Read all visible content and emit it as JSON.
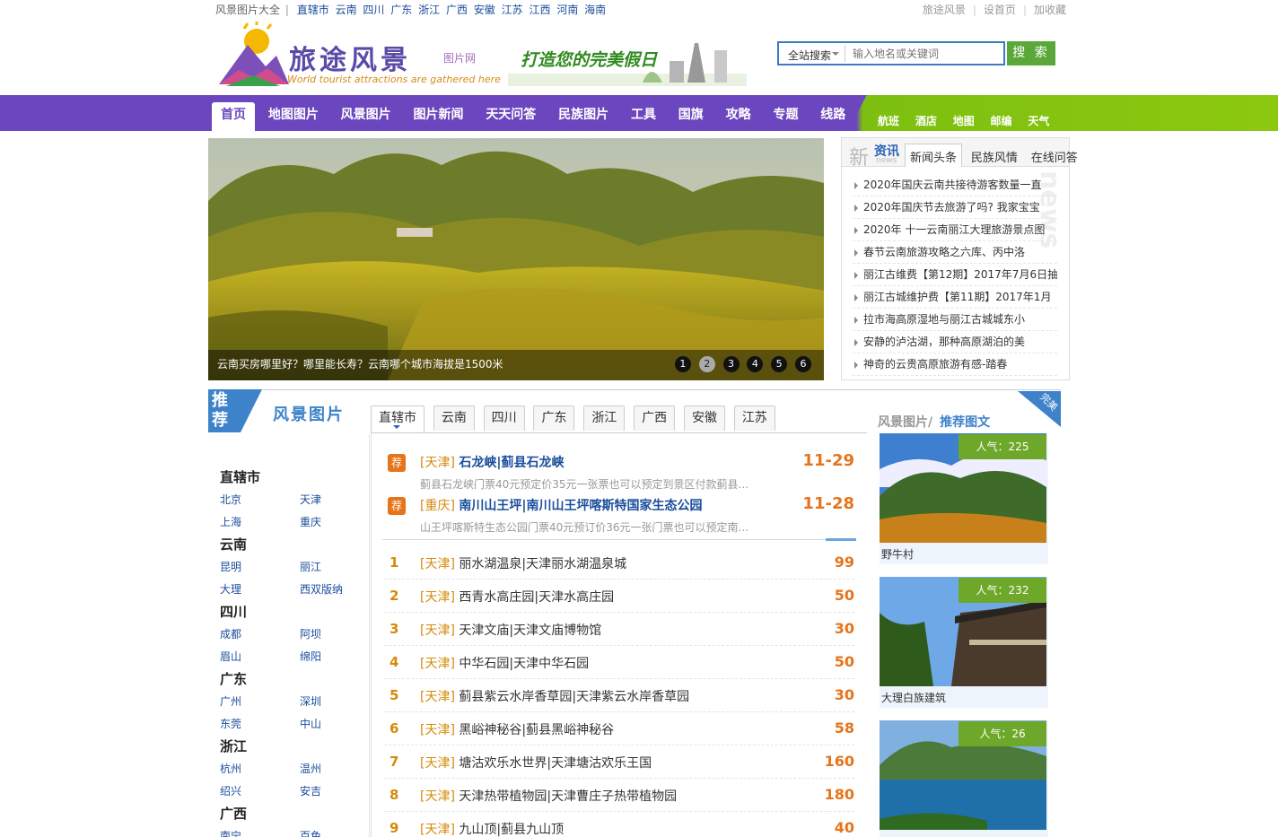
{
  "topbar": {
    "site_label": "风景图片大全",
    "cities": [
      "直辖市",
      "云南",
      "四川",
      "广东",
      "浙江",
      "广西",
      "安徽",
      "江苏",
      "江西",
      "河南",
      "海南"
    ],
    "links": [
      "旅途风景",
      "设首页",
      "加收藏"
    ]
  },
  "header": {
    "logo_title": "旅途风景",
    "logo_sub": "图片网",
    "logo_en": "World tourist attractions are gathered here",
    "slogan": "打造您的完美假日"
  },
  "search": {
    "scope": "全站搜索",
    "placeholder": "输入地名或关键词",
    "button": "搜 索"
  },
  "nav": {
    "items": [
      "首页",
      "地图图片",
      "风景图片",
      "图片新闻",
      "天天问答",
      "民族图片",
      "工具",
      "国旗",
      "攻略",
      "专题",
      "线路"
    ],
    "sub": [
      "航班",
      "酒店",
      "地图",
      "邮编",
      "天气"
    ]
  },
  "banner": {
    "caption": "云南买房哪里好？哪里能长寿？云南哪个城市海拔是1500米",
    "dots": [
      "1",
      "2",
      "3",
      "4",
      "5",
      "6"
    ],
    "active_dot": 2
  },
  "news": {
    "brand_a": "新",
    "brand_b": "资讯",
    "brand_c": "news",
    "watermark": "news",
    "tabs": [
      "新闻头条",
      "民族风情",
      "在线问答"
    ],
    "items": [
      "2020年国庆云南共接待游客数量一直",
      "2020年国庆节去旅游了吗? 我家宝宝",
      "2020年 十一云南丽江大理旅游景点图",
      "春节云南旅游攻略之六库、丙中洛",
      "丽江古维费【第12期】2017年7月6日抽",
      "丽江古城维护费【第11期】2017年1月",
      "拉市海高原湿地与丽江古城城东小",
      "安静的泸沽湖，那种高原湖泊的美",
      "神奇的云贵高原旅游有感-踏春"
    ]
  },
  "recommend": {
    "badge": "推荐",
    "title": "风景图片",
    "side_groups": [
      {
        "name": "直辖市",
        "cities": [
          "北京",
          "天津",
          "上海",
          "重庆"
        ]
      },
      {
        "name": "云南",
        "cities": [
          "昆明",
          "丽江",
          "大理",
          "西双版纳"
        ]
      },
      {
        "name": "四川",
        "cities": [
          "成都",
          "阿坝",
          "眉山",
          "绵阳"
        ]
      },
      {
        "name": "广东",
        "cities": [
          "广州",
          "深圳",
          "东莞",
          "中山"
        ]
      },
      {
        "name": "浙江",
        "cities": [
          "杭州",
          "温州",
          "绍兴",
          "安吉"
        ]
      },
      {
        "name": "广西",
        "cities": [
          "南宁",
          "百色"
        ]
      }
    ],
    "tabs": [
      "直辖市",
      "云南",
      "四川",
      "广东",
      "浙江",
      "广西",
      "安徽",
      "江苏"
    ],
    "hot": [
      {
        "tag": "荐",
        "city": "[天津]",
        "name": "石龙峡|蓟县石龙峡",
        "desc": "蓟县石龙峡门票40元预定价35元一张票也可以预定到景区付款蓟县...",
        "date": "11-29"
      },
      {
        "tag": "荐",
        "city": "[重庆]",
        "name": "南川山王坪|南川山王坪喀斯特国家生态公园",
        "desc": "山王坪喀斯特生态公园门票40元预订价36元一张门票也可以预定南...",
        "date": "11-28"
      }
    ],
    "ranks": [
      {
        "no": "1",
        "city": "[天津]",
        "name": "丽水湖温泉|天津丽水湖温泉城",
        "views": "99"
      },
      {
        "no": "2",
        "city": "[天津]",
        "name": "西青水高庄园|天津水高庄园",
        "views": "50"
      },
      {
        "no": "3",
        "city": "[天津]",
        "name": "天津文庙|天津文庙博物馆",
        "views": "30"
      },
      {
        "no": "4",
        "city": "[天津]",
        "name": "中华石园|天津中华石园",
        "views": "50"
      },
      {
        "no": "5",
        "city": "[天津]",
        "name": "蓟县紫云水岸香草园|天津紫云水岸香草园",
        "views": "30"
      },
      {
        "no": "6",
        "city": "[天津]",
        "name": "黑峪神秘谷|蓟县黑峪神秘谷",
        "views": "58"
      },
      {
        "no": "7",
        "city": "[天津]",
        "name": "塘沽欢乐水世界|天津塘沽欢乐王国",
        "views": "160"
      },
      {
        "no": "8",
        "city": "[天津]",
        "name": "天津热带植物园|天津曹庄子热带植物园",
        "views": "180"
      },
      {
        "no": "9",
        "city": "[天津]",
        "name": "九山顶|蓟县九山顶",
        "views": "40"
      }
    ]
  },
  "pictures": {
    "corner": "完美",
    "cap_a": "风景图片/",
    "cap_b": "推荐图文",
    "cards": [
      {
        "pop": "人气：225",
        "name": "野牛村"
      },
      {
        "pop": "人气：232",
        "name": "大理白族建筑"
      },
      {
        "pop": "人气：26",
        "name": ""
      }
    ]
  },
  "colors": {
    "nav_purple": "#6c46bf",
    "nav_green": "#8cc80f",
    "accent_orange": "#e6741b",
    "link_blue": "#1a4d9c"
  }
}
